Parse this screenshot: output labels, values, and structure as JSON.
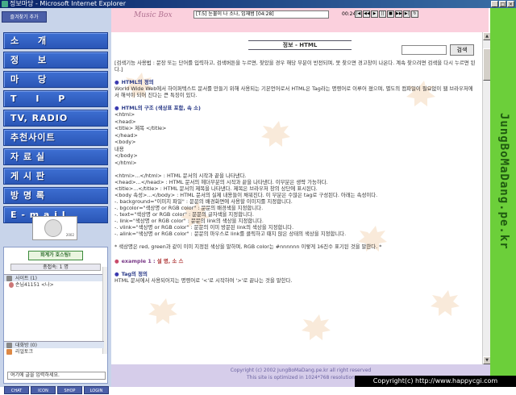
{
  "window": {
    "title": "정보마당 - Microsoft Internet Explorer"
  },
  "sidebar": {
    "favorite_label": "즐겨찾기 추가",
    "items": [
      {
        "label": "소 개"
      },
      {
        "label": "정 보"
      },
      {
        "label": "마 당"
      },
      {
        "label": "T I P"
      },
      {
        "label": "TV, RADIO"
      },
      {
        "label": "추천사이트"
      },
      {
        "label": "자 료 실"
      },
      {
        "label": "게 시 판"
      },
      {
        "label": "방 명 록"
      },
      {
        "label": "E - m a i l"
      }
    ]
  },
  "chat": {
    "host_header": "회계가 호스팅!",
    "count_label": "총접속: 1 명",
    "site_label": "사이트 (1)",
    "user": "손님41151 <나>",
    "room_label": "대화방 (0)",
    "realtalk_label": "리얼토크",
    "message_placeholder": "여기에 글을 입력하세요.",
    "tabs": [
      "CHAT",
      "ICON",
      "SHOP",
      "LOGIN"
    ]
  },
  "music": {
    "label": "Music Box",
    "song": "[T:5] 눈물이 나 소나, 임재범 [04:28]",
    "time": "00:24"
  },
  "content": {
    "heading": "정보 - HTML",
    "search_button": "검색",
    "intro": "[검색기능 사용법 : 문장 또는 단어를 입력하고, 검색버튼을 누르면, 찾았을 경우 해당 부분이 반전되며, 못 찾으면 경고창이 나온다. 계속 찾으려면 검색을 다시 누르면 된다.]",
    "sec1": "HTML의 정의",
    "sec1_text": "World Wide Web에서 하이퍼텍스트 문서를 만들기 위해 사용되는 기본언어로서 HTML은 Tag라는 명령어로 이루어 졌으며, 별도의 컴파일이 필요없이 웹 브라우저에서 해석이 되어 진다는 큰 특징이 있다.",
    "sec2": "HTML의 구조 (색상표 포함, 속 소)",
    "code": [
      "<html>",
      " <head>",
      "  <title> 제목 </title>",
      " </head>",
      " <body>",
      "  내용",
      " </body>",
      "</html>"
    ],
    "bullets": [
      "<html>...</html> : HTML 문서의 시작과 끝을 나타낸다.",
      "<head>...</head> : HTML 문서의 헤더부분의 시작과 끝을 나타낸다. 이부분은 생략 가능하다.",
      "<title>...</title> : HTML 문서의 제목을 나타낸다. 제목은 브라우저 창의 상단에 표시된다.",
      "<body 속성>...</body> : HTML 문서의 실제 내용들이 채워진다. 이 부분은 수많은 tag로 구성된다. 아래는 속성이다.",
      "-. background=\"이미지 파일\" : 문문의 배경화면에 사용할 이미지를 지정합니다.",
      "-. bgcolor=\"색상명 or RGB color\" : 문문의 배경색을 지정합니다.",
      "-. text=\"색상명 or RGB color\" : 문문의 글자색을 지정합니다.",
      "-. link=\"색상명 or RGB color\" : 문문의 link의 색상을 지정합니다.",
      "-. vlink=\"색상명 or RGB color\" : 문문의 이미 방문된 link의 색상을 지정합니다.",
      "-. alink=\"색상명 or RGB color\" : 문문의 마우스로 link를 클릭하고 때지 않은 상태의 색상을 지정합니다."
    ],
    "note": "* 색상명은 red, green과 같이 이미 지정된 색상을 말하며, RGB color는 #nnnnnn 이렇게 16진수 표기된 것을 말한다. *",
    "example_label": "example 1 :",
    "example_value": "설 명, 소 스",
    "sec3": "Tag의 정의",
    "sec3_text": "HTML 문서에서 사용되어지는 명령어로 '<'로 시작하여 '>'로 끝나는 것을 말한다."
  },
  "banner": {
    "text": "JungBoMaDang.pe.kr"
  },
  "footer": {
    "line1": "Copyright (c) 2002 JungBoMaDang.pe.kr all right reserved",
    "line2": "This site is optimized in 1024*768 resolution"
  },
  "watermark": "Copyright(c) http://www.happycgi.com"
}
